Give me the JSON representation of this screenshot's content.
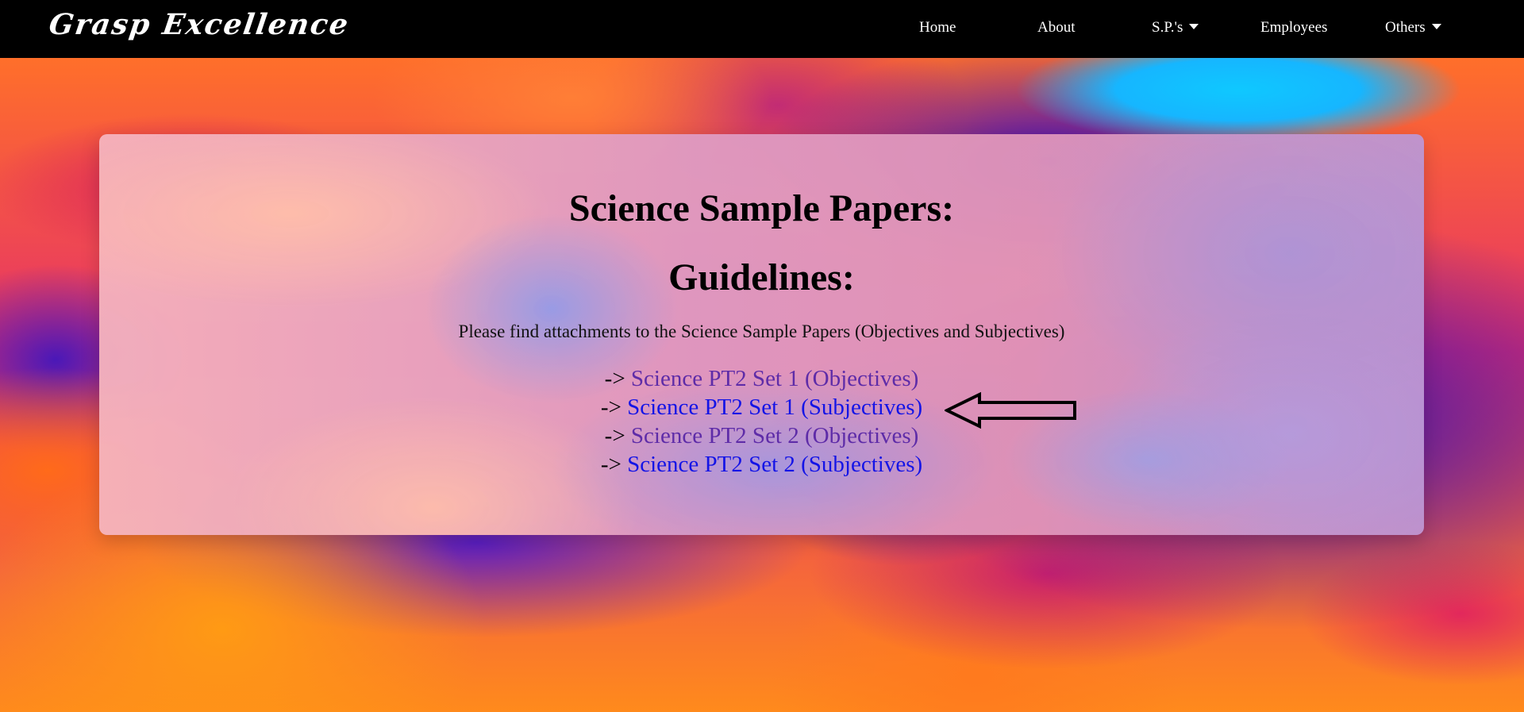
{
  "navbar": {
    "brand": "Grasp Excellence",
    "items": [
      {
        "label": "Home"
      },
      {
        "label": "About"
      },
      {
        "label": "S.P.'s",
        "dropdown": true
      },
      {
        "label": "Employees"
      },
      {
        "label": "Others",
        "dropdown": true
      }
    ]
  },
  "main": {
    "title": "Science Sample Papers:",
    "subtitle": "Guidelines:",
    "description": "Please find attachments to the Science Sample Papers (Objectives and Subjectives)",
    "link_prefix": "->",
    "links": [
      {
        "label": "Science PT2 Set 1 (Objectives)",
        "state": "visited"
      },
      {
        "label": "Science PT2 Set 1 (Subjectives)",
        "state": "unvisited"
      },
      {
        "label": "Science PT2 Set 2 (Objectives)",
        "state": "visited"
      },
      {
        "label": "Science PT2 Set 2 (Subjectives)",
        "state": "unvisited"
      }
    ]
  },
  "colors": {
    "navbar_bg": "#000000",
    "visited_link": "#5e2ca8",
    "unvisited_link": "#1414e6"
  },
  "icons": {
    "pointer_arrow": "left-arrow-outline-icon",
    "dropdown": "caret-down-icon"
  }
}
